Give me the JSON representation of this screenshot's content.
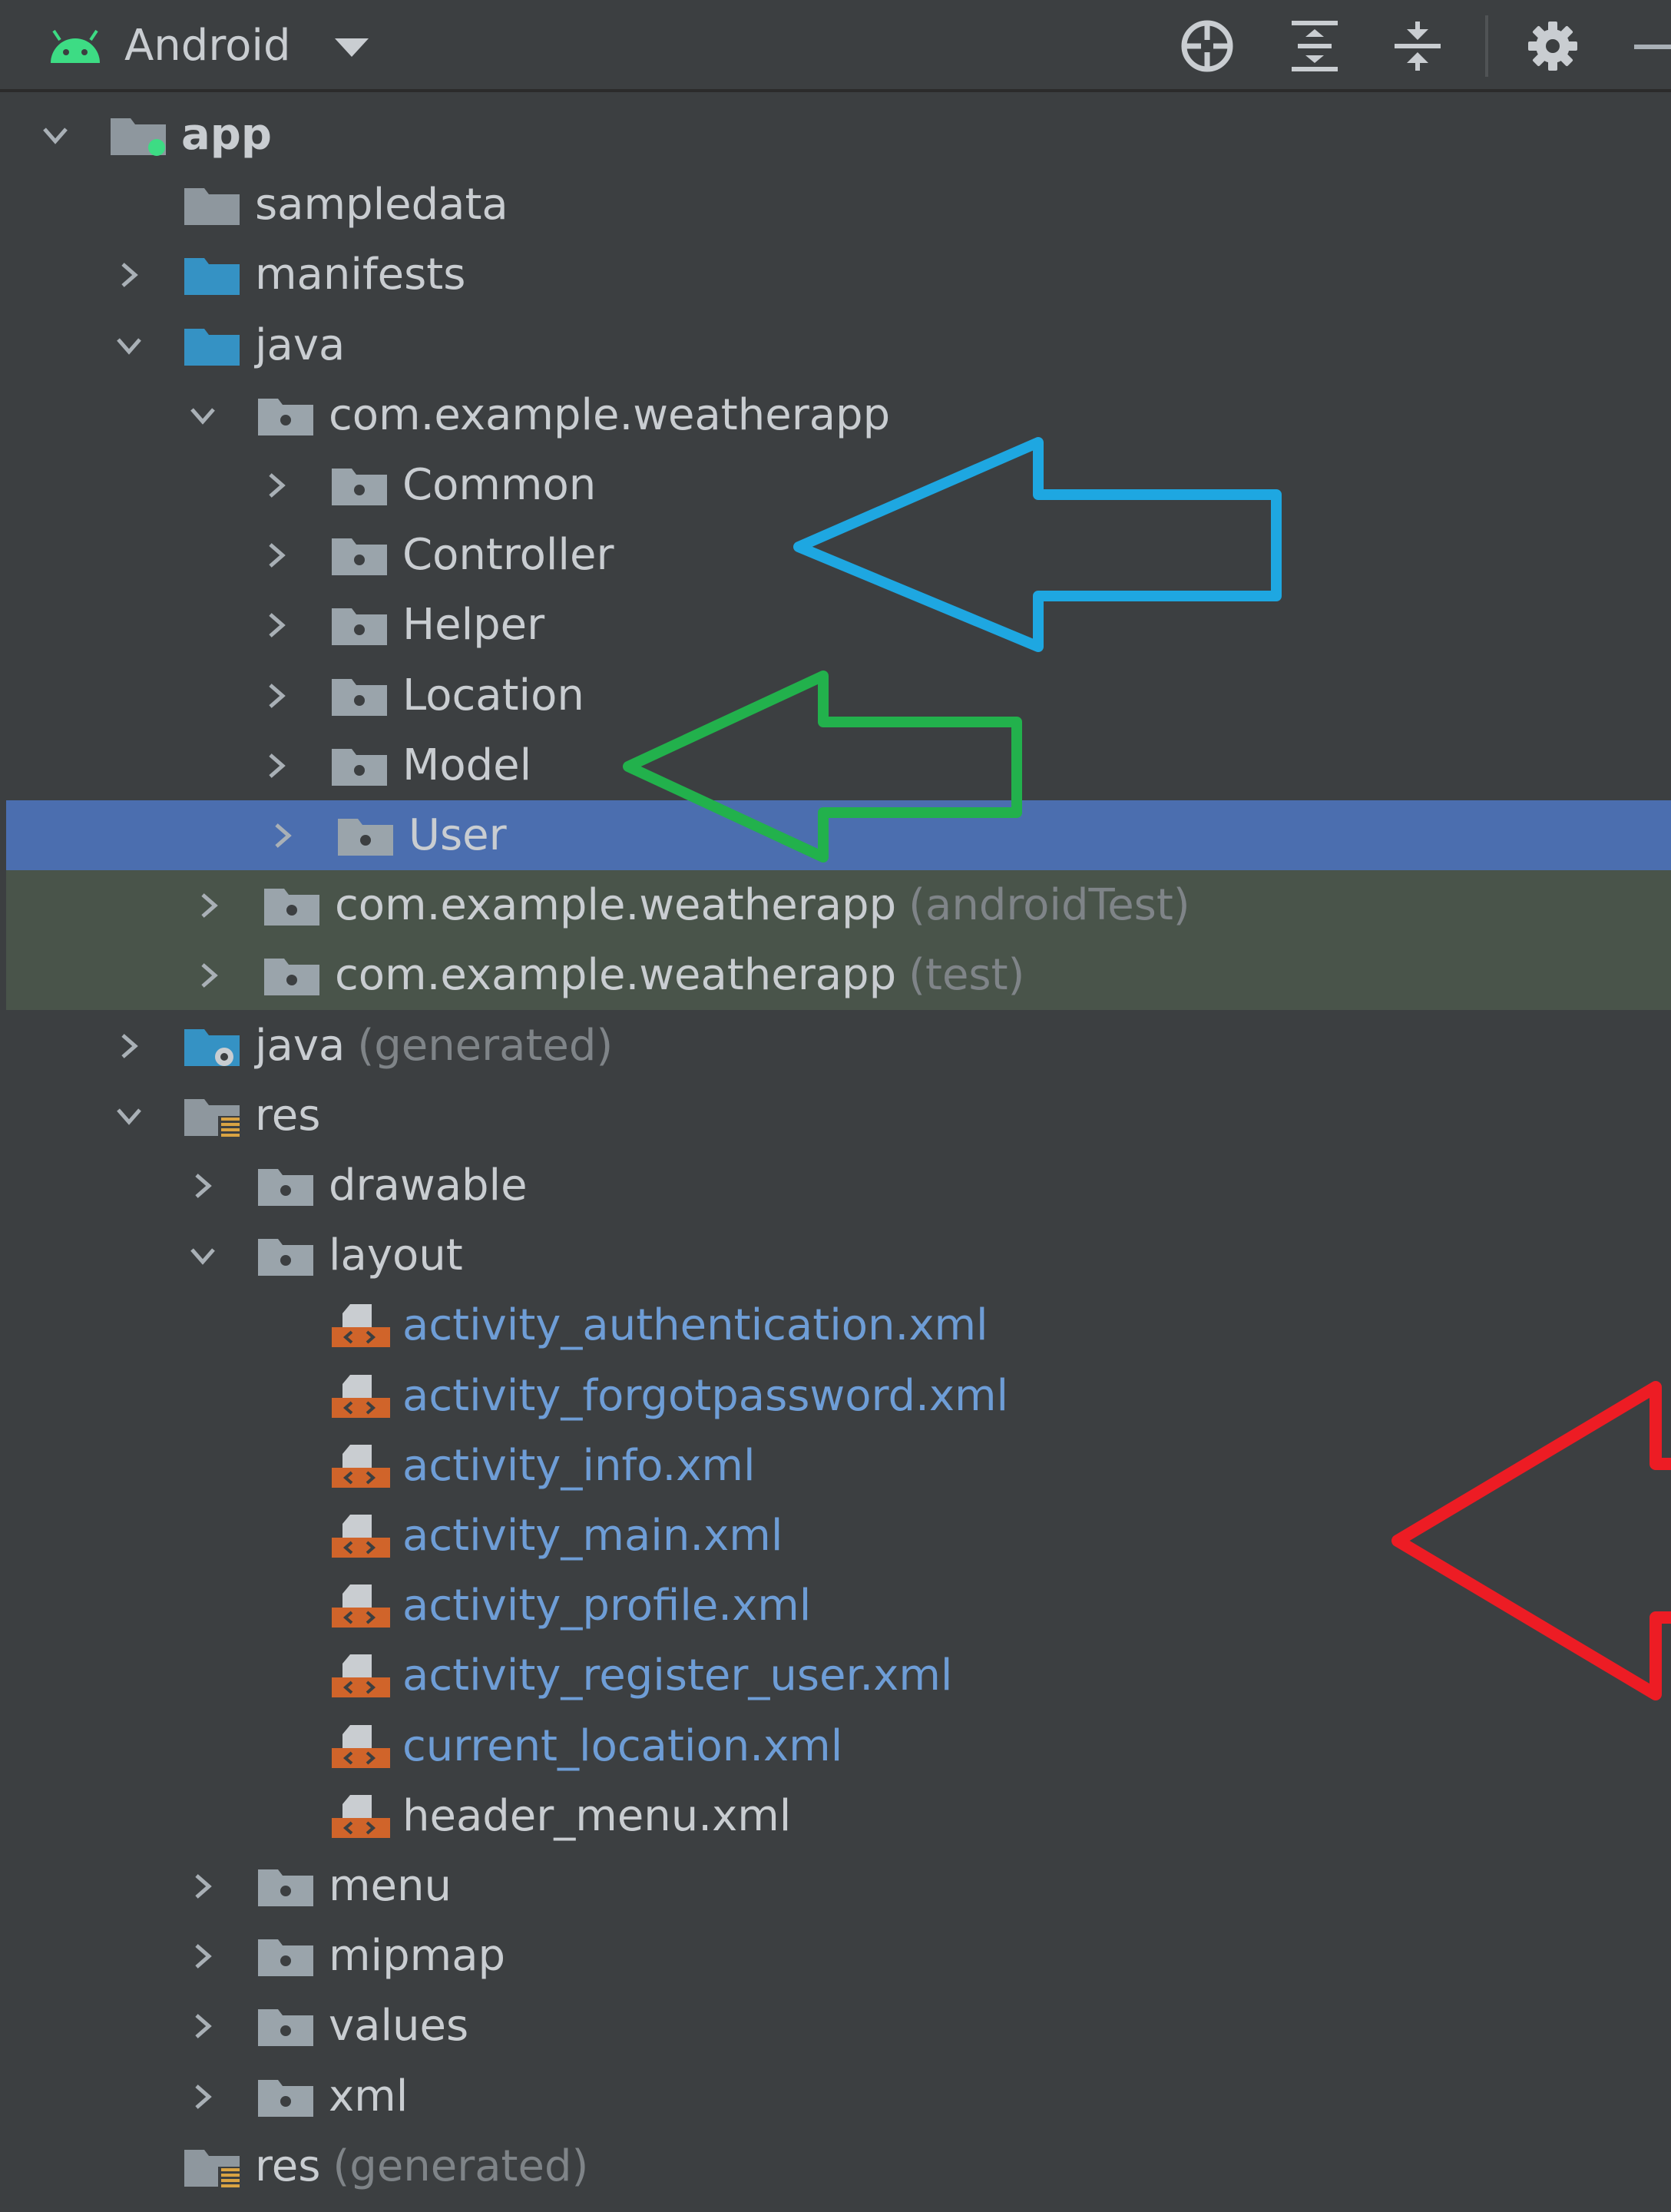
{
  "toolbar": {
    "view_label": "Android",
    "icons": [
      "android-icon",
      "dropdown-icon",
      "locate-icon",
      "expand-all-icon",
      "collapse-all-icon",
      "gear-icon",
      "minimize-icon"
    ]
  },
  "tree": [
    {
      "label": "app",
      "icon": "module-folder-icon"
    },
    {
      "label": "sampledata",
      "icon": "folder-icon"
    },
    {
      "label": "manifests",
      "icon": "source-folder-icon"
    },
    {
      "label": "java",
      "icon": "source-folder-icon"
    },
    {
      "label": "com.example.weatherapp",
      "icon": "package-icon"
    },
    {
      "label": "Common",
      "icon": "package-icon"
    },
    {
      "label": "Controller",
      "icon": "package-icon"
    },
    {
      "label": "Helper",
      "icon": "package-icon"
    },
    {
      "label": "Location",
      "icon": "package-icon"
    },
    {
      "label": "Model",
      "icon": "package-icon"
    },
    {
      "label": "User",
      "icon": "package-icon",
      "selected": true
    },
    {
      "label": "com.example.weatherapp",
      "sub": "(androidTest)",
      "icon": "package-icon"
    },
    {
      "label": "com.example.weatherapp",
      "sub": "(test)",
      "icon": "package-icon"
    },
    {
      "label": "java",
      "sub": "(generated)",
      "icon": "generated-folder-icon"
    },
    {
      "label": "res",
      "icon": "resource-folder-icon"
    },
    {
      "label": "drawable",
      "icon": "package-icon"
    },
    {
      "label": "layout",
      "icon": "package-icon"
    },
    {
      "label": "activity_authentication.xml",
      "icon": "xml-layout-icon"
    },
    {
      "label": "activity_forgotpassword.xml",
      "icon": "xml-layout-icon"
    },
    {
      "label": "activity_info.xml",
      "icon": "xml-layout-icon"
    },
    {
      "label": "activity_main.xml",
      "icon": "xml-layout-icon"
    },
    {
      "label": "activity_profile.xml",
      "icon": "xml-layout-icon"
    },
    {
      "label": "activity_register_user.xml",
      "icon": "xml-layout-icon"
    },
    {
      "label": "current_location.xml",
      "icon": "xml-layout-icon"
    },
    {
      "label": "header_menu.xml",
      "icon": "xml-layout-icon"
    },
    {
      "label": "menu",
      "icon": "package-icon"
    },
    {
      "label": "mipmap",
      "icon": "package-icon"
    },
    {
      "label": "values",
      "icon": "package-icon"
    },
    {
      "label": "xml",
      "icon": "package-icon"
    },
    {
      "label": "res",
      "sub": "(generated)",
      "icon": "resource-folder-icon"
    }
  ],
  "annotations": [
    {
      "name": "blue-arrow",
      "color": "#1ea7e1",
      "points_to": "Controller"
    },
    {
      "name": "green-arrow",
      "color": "#22b14c",
      "points_to": "Model"
    },
    {
      "name": "red-arrow",
      "color": "#ed1c24",
      "points_to": "activity_main.xml"
    }
  ],
  "colors": {
    "background": "#3c3f41",
    "selection": "#4b6eaf",
    "test_background": "#49544a",
    "text": "#c9cdd1",
    "modified_file_text": "#6e9dd6",
    "dim_text": "#7f8488"
  }
}
